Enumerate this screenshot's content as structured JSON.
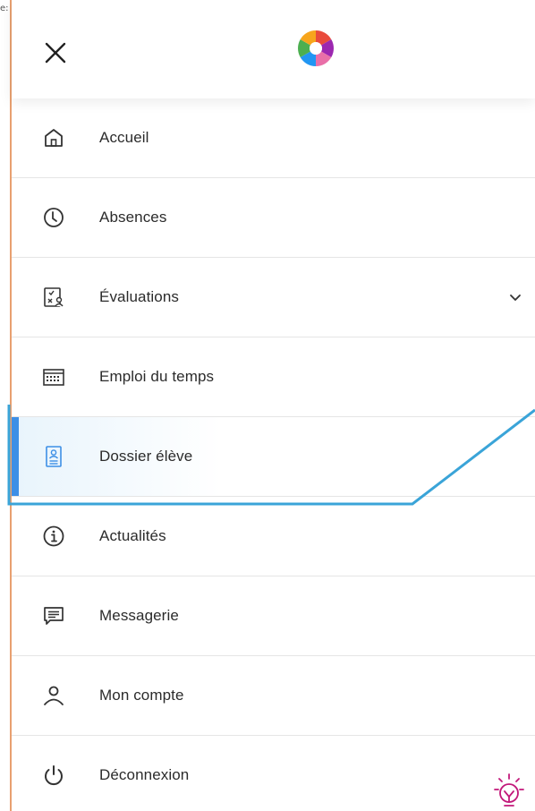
{
  "edge": {
    "text": "e:"
  },
  "header": {
    "close_icon": "close-icon",
    "logo_colors": [
      "#e94b3c",
      "#f7a51c",
      "#4caf50",
      "#2196f3",
      "#9c27b0"
    ]
  },
  "menu": {
    "items": [
      {
        "label": "Accueil",
        "icon": "home-icon"
      },
      {
        "label": "Absences",
        "icon": "clock-icon"
      },
      {
        "label": "Évaluations",
        "icon": "evaluation-icon",
        "expandable": true
      },
      {
        "label": "Emploi du temps",
        "icon": "calendar-icon"
      },
      {
        "label": "Dossier élève",
        "icon": "student-file-icon",
        "active": true
      },
      {
        "label": "Actualités",
        "icon": "info-icon"
      },
      {
        "label": "Messagerie",
        "icon": "message-icon"
      },
      {
        "label": "Mon compte",
        "icon": "user-icon"
      },
      {
        "label": "Déconnexion",
        "icon": "power-icon"
      }
    ]
  },
  "colors": {
    "accent": "#3d8fe6",
    "annotation": "#3aa4d8",
    "bulb": "#c2187a",
    "text": "#2b2b2b",
    "divider": "#e5e5e5"
  }
}
